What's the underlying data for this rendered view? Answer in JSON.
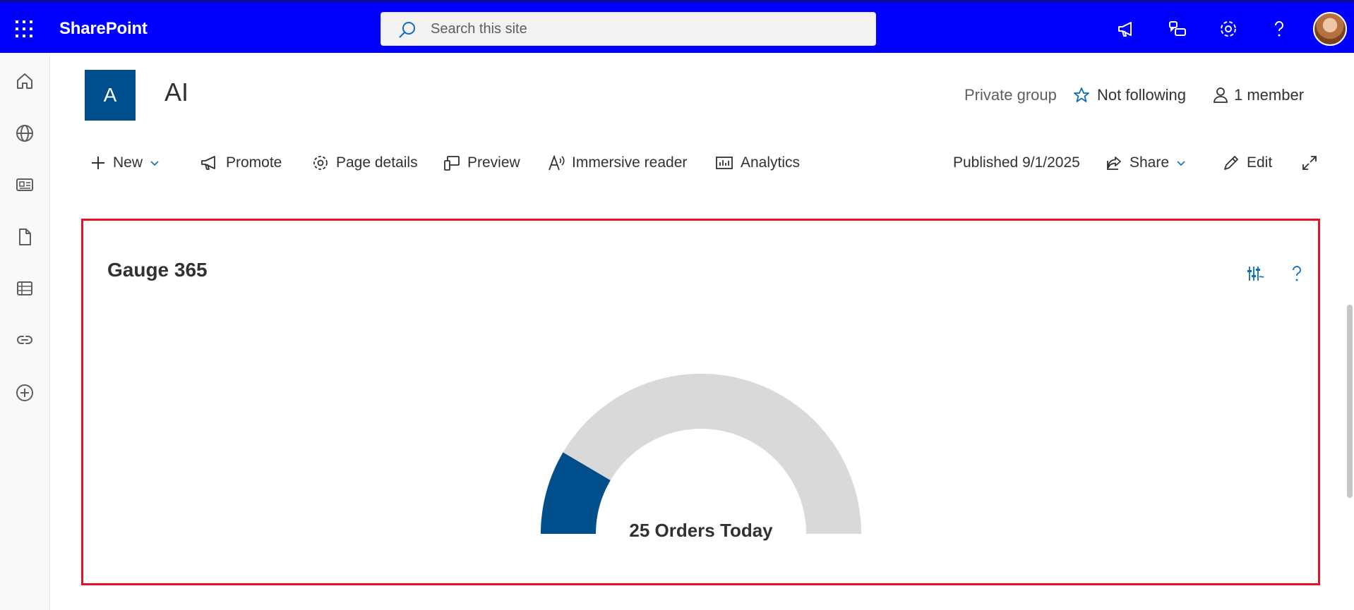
{
  "topbar": {
    "app_name": "SharePoint",
    "search_placeholder": "Search this site",
    "icons": [
      "waffle-icon",
      "megaphone-icon",
      "chat-icon",
      "gear-icon",
      "help-icon",
      "avatar"
    ],
    "background": "#0000ff"
  },
  "leftrail": {
    "items": [
      "home-icon",
      "globe-icon",
      "news-icon",
      "document-icon",
      "list-icon",
      "link-icon",
      "add-icon"
    ]
  },
  "site": {
    "logo_letter": "A",
    "title": "AI",
    "privacy": "Private group",
    "follow": "Not following",
    "members": "1 member"
  },
  "commandbar": {
    "new": "New",
    "promote": "Promote",
    "page_details": "Page details",
    "preview": "Preview",
    "immersive_reader": "Immersive reader",
    "analytics": "Analytics",
    "published": "Published 9/1/2025",
    "share": "Share",
    "edit": "Edit"
  },
  "webpart": {
    "title": "Gauge 365",
    "gauge": {
      "label": "25 Orders Today",
      "fraction": 0.17,
      "fill_color": "#004e8c",
      "track_color": "#d9d9d9"
    },
    "border_color": "#e81123"
  }
}
